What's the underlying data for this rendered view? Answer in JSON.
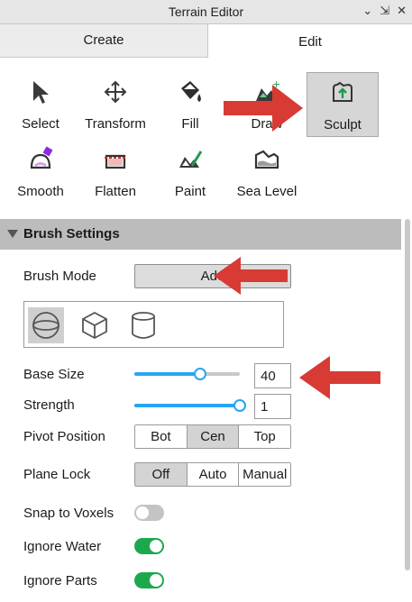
{
  "window": {
    "title": "Terrain Editor",
    "controls": [
      "⌄",
      "⇲",
      "✕"
    ]
  },
  "tabs": [
    {
      "label": "Create"
    },
    {
      "label": "Edit"
    }
  ],
  "tools": [
    {
      "label": "Select",
      "icon": "cursor-icon"
    },
    {
      "label": "Transform",
      "icon": "move-arrows-icon"
    },
    {
      "label": "Fill",
      "icon": "paint-bucket-icon"
    },
    {
      "label": "Draw",
      "icon": "terrain-draw-icon"
    },
    {
      "label": "Sculpt",
      "icon": "terrain-sculpt-icon",
      "selected": true
    },
    {
      "label": "Smooth",
      "icon": "smooth-icon"
    },
    {
      "label": "Flatten",
      "icon": "flatten-icon"
    },
    {
      "label": "Paint",
      "icon": "terrain-paint-icon"
    },
    {
      "label": "Sea Level",
      "icon": "sea-level-icon"
    }
  ],
  "brush": {
    "section_title": "Brush Settings",
    "mode_label": "Brush Mode",
    "mode_value": "Add",
    "shapes": [
      "sphere-icon",
      "cube-icon",
      "cylinder-icon"
    ],
    "selected_shape": "sphere-icon",
    "base_size_label": "Base Size",
    "base_size_value": "40",
    "base_size_fraction": 0.62,
    "strength_label": "Strength",
    "strength_value": "1",
    "strength_fraction": 1.0,
    "pivot_label": "Pivot Position",
    "pivot_options": [
      "Bot",
      "Cen",
      "Top"
    ],
    "pivot_selected": "Cen",
    "plane_lock_label": "Plane Lock",
    "plane_lock_options": [
      "Off",
      "Auto",
      "Manual"
    ],
    "plane_lock_selected": "Off",
    "snap_label": "Snap to Voxels",
    "snap_on": false,
    "ignore_water_label": "Ignore Water",
    "ignore_water_on": true,
    "ignore_parts_label": "Ignore Parts",
    "ignore_parts_on": true
  },
  "colors": {
    "accent_blue": "#29a4f3",
    "toggle_on": "#1ea84e",
    "toggle_off": "#c4c4c4",
    "annotation_arrow": "#d83a34",
    "section_header": "#bcbcbc"
  }
}
